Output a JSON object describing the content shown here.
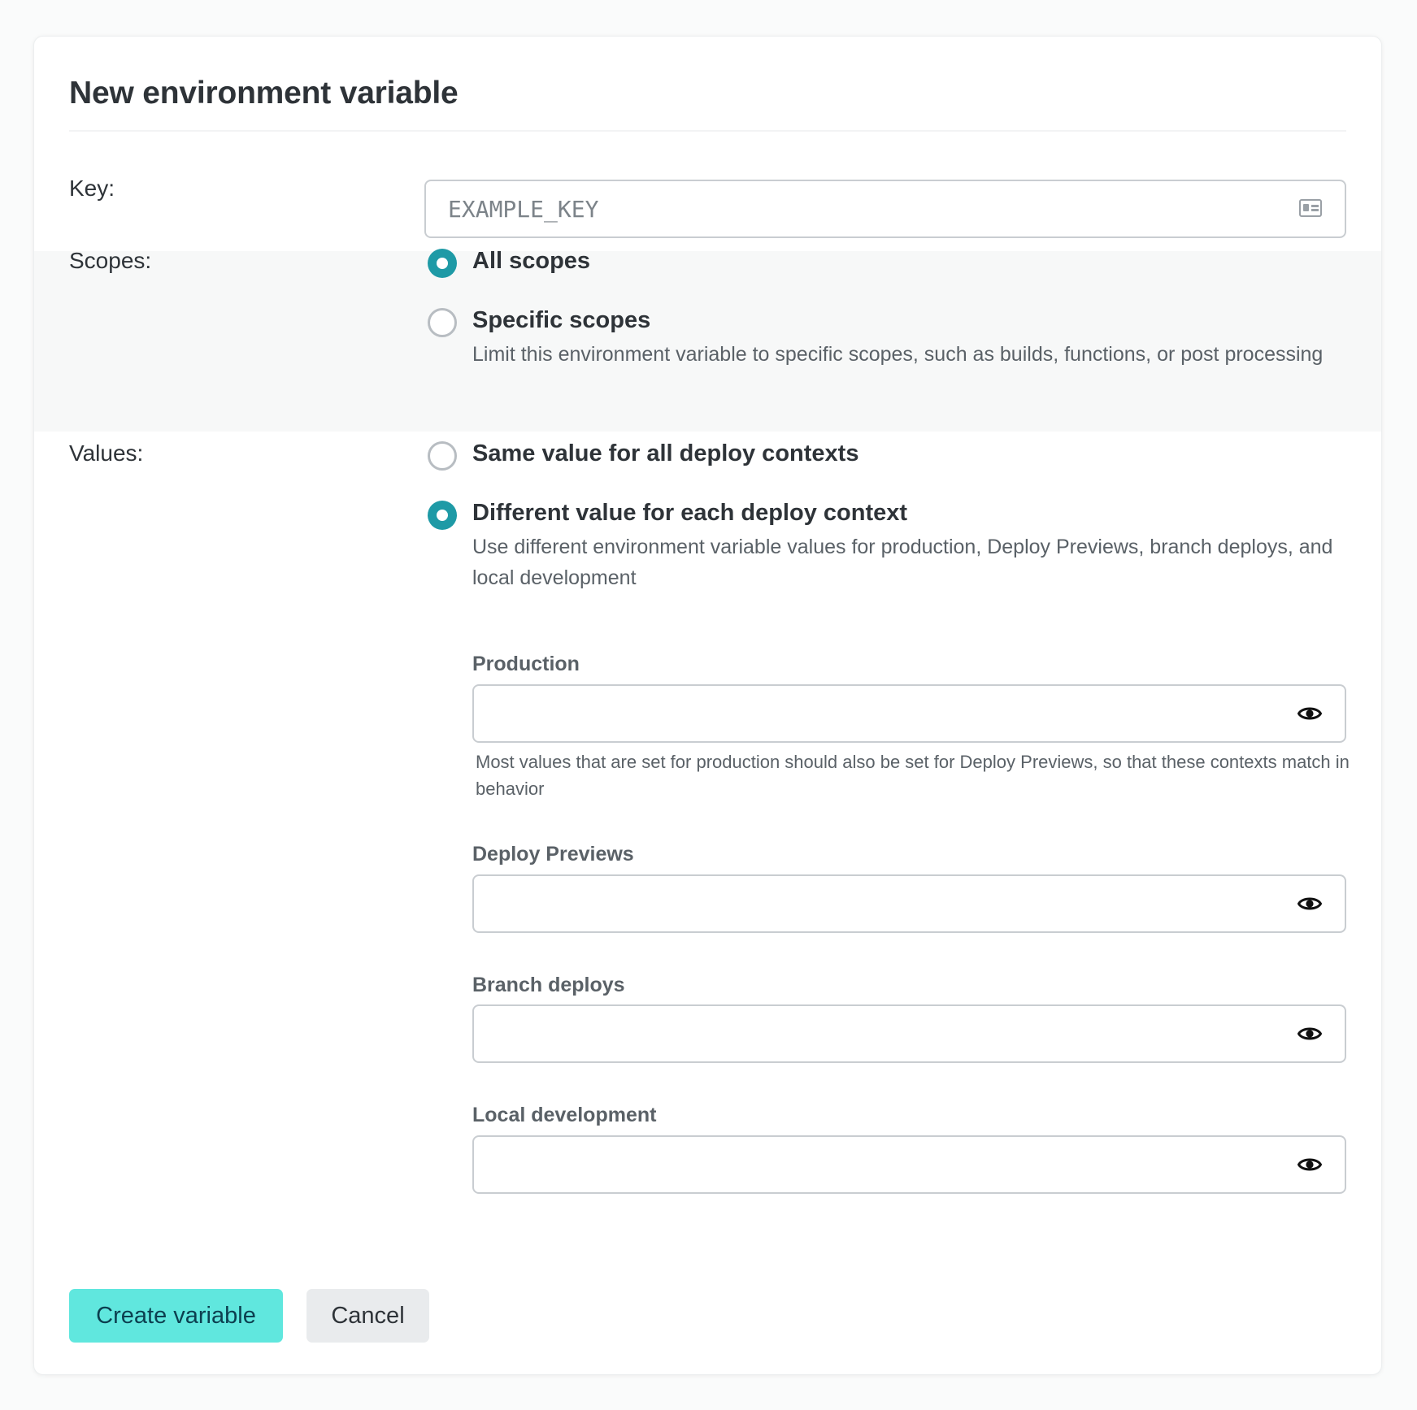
{
  "dialog": {
    "title": "New environment variable"
  },
  "key": {
    "label": "Key:",
    "placeholder": "EXAMPLE_KEY",
    "icon": "contact-card-icon"
  },
  "scopes": {
    "label": "Scopes:",
    "options": [
      {
        "label": "All scopes",
        "selected": true,
        "description": ""
      },
      {
        "label": "Specific scopes",
        "selected": false,
        "description": "Limit this environment variable to specific scopes, such as builds, functions, or post processing"
      }
    ]
  },
  "values": {
    "label": "Values:",
    "options": [
      {
        "label": "Same value for all deploy contexts",
        "selected": false,
        "description": ""
      },
      {
        "label": "Different value for each deploy context",
        "selected": true,
        "description": "Use different environment variable values for production, Deploy Previews, branch deploys, and local development"
      }
    ],
    "contexts": [
      {
        "label": "Production",
        "value": "",
        "help": "Most values that are set for production should also be set for Deploy Previews, so that these contexts match in behavior"
      },
      {
        "label": "Deploy Previews",
        "value": ""
      },
      {
        "label": "Branch deploys",
        "value": ""
      },
      {
        "label": "Local development",
        "value": ""
      }
    ]
  },
  "actions": {
    "create_label": "Create variable",
    "cancel_label": "Cancel"
  },
  "colors": {
    "accent": "#1e9aa6",
    "primary_button": "#60e7de",
    "secondary_button": "#e9ebed",
    "scopes_band": "#f7f8f8"
  }
}
